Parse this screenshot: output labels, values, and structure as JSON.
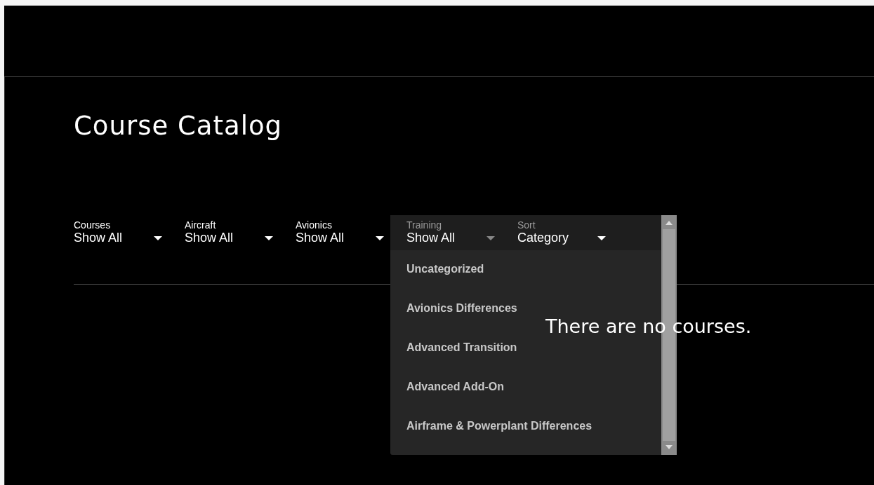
{
  "title": "Course Catalog",
  "filters": [
    {
      "label": "Courses",
      "value": "Show All",
      "expanded": false
    },
    {
      "label": "Aircraft",
      "value": "Show All",
      "expanded": false
    },
    {
      "label": "Avionics",
      "value": "Show All",
      "expanded": false
    },
    {
      "label": "Training",
      "value": "Show All",
      "expanded": true
    },
    {
      "label": "Sort",
      "value": "Category",
      "expanded": false
    }
  ],
  "dropdown_options": [
    "Uncategorized",
    "Avionics Differences",
    "Advanced Transition",
    "Advanced Add-On",
    "Airframe & Powerplant Differences"
  ],
  "empty_message": "There are no courses."
}
